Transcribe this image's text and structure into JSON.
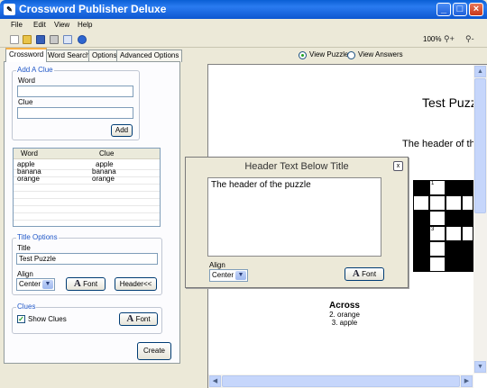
{
  "window": {
    "title": "Crossword Publisher Deluxe",
    "min": "_",
    "max": "□",
    "close": "×"
  },
  "menu": [
    "File",
    "Edit",
    "View",
    "Help"
  ],
  "toolbar": {
    "zoom": "100%",
    "zoom_in": "+",
    "zoom_out": "-"
  },
  "tabs": [
    "Crossword",
    "Word Search",
    "Options",
    "Advanced Options"
  ],
  "add_clue": {
    "group": "Add A Clue",
    "word_label": "Word",
    "word_value": "",
    "clue_label": "Clue",
    "clue_value": "",
    "add_button": "Add"
  },
  "clue_list": {
    "columns": [
      "Word",
      "Clue"
    ],
    "rows": [
      {
        "word": "apple",
        "clue": "apple"
      },
      {
        "word": "banana",
        "clue": "banana"
      },
      {
        "word": "orange",
        "clue": "orange"
      }
    ]
  },
  "title_options": {
    "group": "Title Options",
    "title_label": "Title",
    "title_value": "Test Puzzle",
    "align_label": "Align",
    "align_value": "Center",
    "font_button": "Font",
    "header_button": "Header<<"
  },
  "clues_options": {
    "group": "Clues",
    "show_clues_label": "Show Clues",
    "show_clues_checked": true,
    "font_button": "Font"
  },
  "create_button": "Create",
  "view_mode": {
    "puzzle": "View Puzzle",
    "answers": "View Answers",
    "selected": "puzzle"
  },
  "preview": {
    "title": "Test Puzz",
    "header": "The header of the",
    "across_heading": "Across",
    "across_items": [
      "2. orange",
      "3. apple"
    ],
    "grid_numbers": [
      "1",
      "3"
    ]
  },
  "header_dialog": {
    "title": "Header Text Below Title",
    "close": "x",
    "text": "The header of the puzzle",
    "align_label": "Align",
    "align_value": "Center",
    "font_button": "Font"
  },
  "font_glyph": "A",
  "colors": {
    "titlebar": "#0a5fd4",
    "groupbox_label": "#2158c8",
    "check": "#21a121"
  }
}
